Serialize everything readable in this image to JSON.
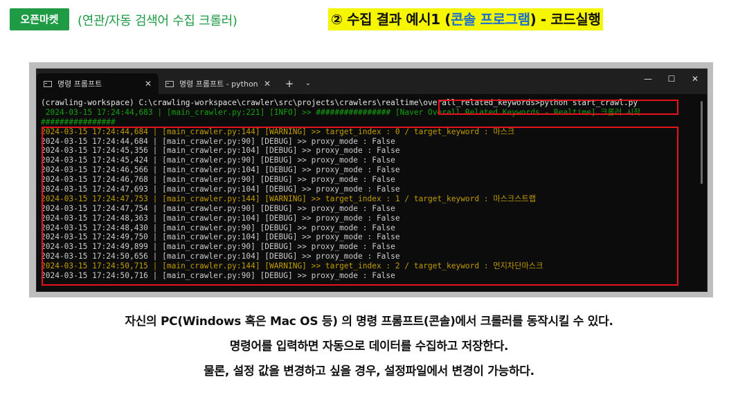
{
  "header": {
    "badge": "오픈마켓",
    "subtitle": "(연관/자동 검색어 수집 크롤러)",
    "headline_part1": "② 수집 결과 예시1 (",
    "headline_highlight": "콘솔 프로그램",
    "headline_part2": ") - 코드실행",
    "badge_color": "#1f9a45",
    "headline_bg": "#f6f600",
    "highlight_box_color": "#e8121c"
  },
  "terminal": {
    "tabs": [
      {
        "label": "명령 프롬프트",
        "active": true
      },
      {
        "label": "명령 프롬프트 - python  crawl",
        "active": false
      }
    ],
    "close_glyph": "✕",
    "new_tab_glyph": "+",
    "dropdown_glyph": "⌄",
    "window_controls": {
      "minimize": "—",
      "maximize": "☐",
      "close": "✕"
    },
    "lines": [
      {
        "type": "cmd",
        "text": "(crawling-workspace) C:\\crawling-workspace\\crawler\\src\\projects\\crawlers\\realtime\\overall_related_keywords>python start_crawl.py"
      },
      {
        "type": "info",
        "text": " 2024-03-15 17:24:44,683 | [main_crawler.py:221] [INFO] >> ################ [Naver Overall Related Keywords - Realtime] 크롤러 시작"
      },
      {
        "type": "info",
        "text": "################"
      },
      {
        "type": "warn",
        "text": "2024-03-15 17:24:44,684 | [main_crawler.py:144] [WARNING] >> target_index : 0 / target_keyword : 마스크"
      },
      {
        "type": "debug",
        "text": "2024-03-15 17:24:44,684 | [main_crawler.py:90] [DEBUG] >> proxy_mode : False"
      },
      {
        "type": "debug",
        "text": "2024-03-15 17:24:45,356 | [main_crawler.py:104] [DEBUG] >> proxy_mode : False"
      },
      {
        "type": "debug",
        "text": "2024-03-15 17:24:45,424 | [main_crawler.py:90] [DEBUG] >> proxy_mode : False"
      },
      {
        "type": "debug",
        "text": "2024-03-15 17:24:46,566 | [main_crawler.py:104] [DEBUG] >> proxy_mode : False"
      },
      {
        "type": "debug",
        "text": "2024-03-15 17:24:46,768 | [main_crawler.py:90] [DEBUG] >> proxy_mode : False"
      },
      {
        "type": "debug",
        "text": "2024-03-15 17:24:47,693 | [main_crawler.py:104] [DEBUG] >> proxy_mode : False"
      },
      {
        "type": "warn",
        "text": "2024-03-15 17:24:47,753 | [main_crawler.py:144] [WARNING] >> target_index : 1 / target_keyword : 마스크스트랩"
      },
      {
        "type": "debug",
        "text": "2024-03-15 17:24:47,754 | [main_crawler.py:90] [DEBUG] >> proxy_mode : False"
      },
      {
        "type": "debug",
        "text": "2024-03-15 17:24:48,363 | [main_crawler.py:104] [DEBUG] >> proxy_mode : False"
      },
      {
        "type": "debug",
        "text": "2024-03-15 17:24:48,430 | [main_crawler.py:90] [DEBUG] >> proxy_mode : False"
      },
      {
        "type": "debug",
        "text": "2024-03-15 17:24:49,750 | [main_crawler.py:104] [DEBUG] >> proxy_mode : False"
      },
      {
        "type": "debug",
        "text": "2024-03-15 17:24:49,899 | [main_crawler.py:90] [DEBUG] >> proxy_mode : False"
      },
      {
        "type": "debug",
        "text": "2024-03-15 17:24:50,656 | [main_crawler.py:104] [DEBUG] >> proxy_mode : False"
      },
      {
        "type": "warn",
        "text": "2024-03-15 17:24:50,715 | [main_crawler.py:144] [WARNING] >> target_index : 2 / target_keyword : 먼지차단마스크"
      },
      {
        "type": "debug",
        "text": "2024-03-15 17:24:50,716 | [main_crawler.py:90] [DEBUG] >> proxy_mode : False"
      }
    ]
  },
  "captions": [
    "자신의 PC(Windows 혹은 Mac OS 등) 의 명령 프롬프트(콘솔)에서 크롤러를 동작시킬 수 있다.",
    "명령어를 입력하면 자동으로 데이터를 수집하고 저장한다.",
    "물론, 설정 값을 변경하고 싶을 경우, 설정파일에서 변경이 가능하다."
  ]
}
